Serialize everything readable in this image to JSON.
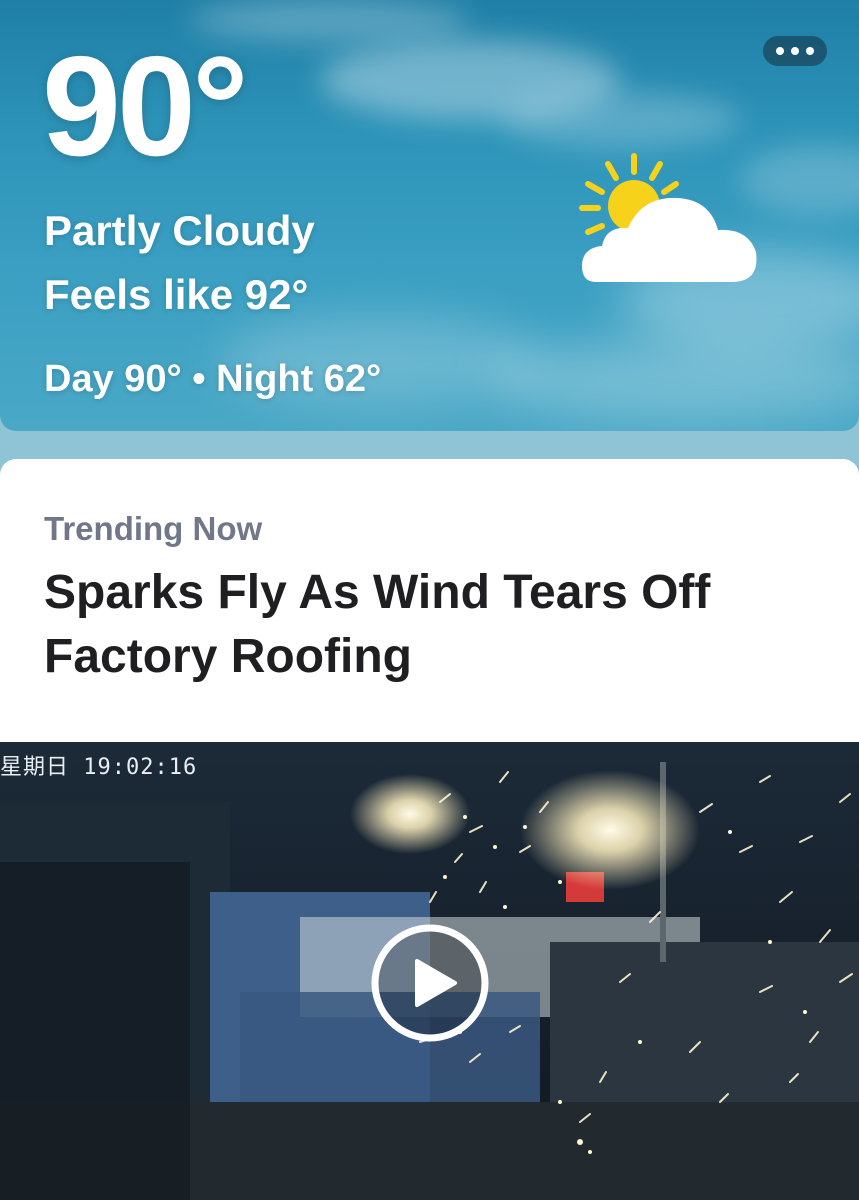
{
  "weather": {
    "temperature": "90°",
    "condition": "Partly Cloudy",
    "feels_like": "Feels like 92°",
    "day_night": "Day 90° • Night 62°",
    "icon": "partly-cloudy-icon",
    "more_icon": "more-icon"
  },
  "trending": {
    "label": "Trending Now",
    "headline": "Sparks Fly As Wind Tears Off Factory Roofing",
    "video": {
      "timestamp": "星期日 19:02:16",
      "play_icon": "play-icon"
    }
  }
}
